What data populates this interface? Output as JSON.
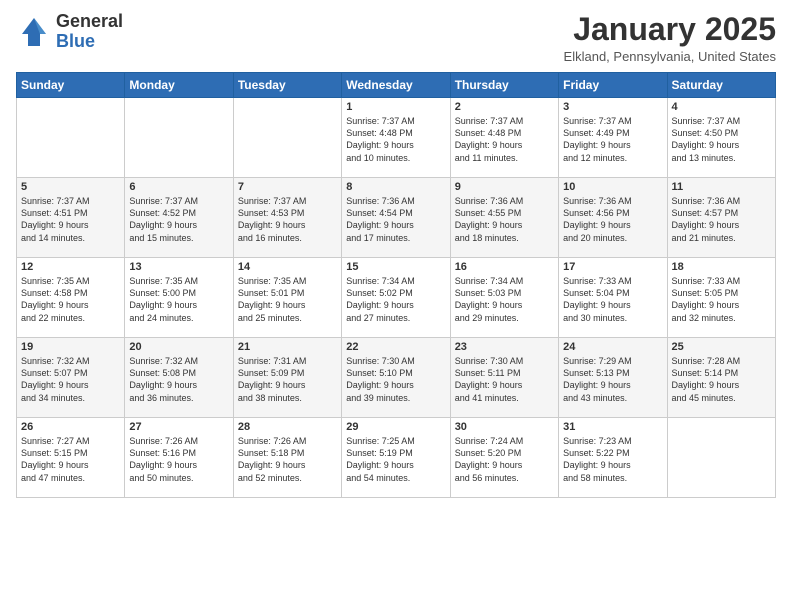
{
  "header": {
    "logo_general": "General",
    "logo_blue": "Blue",
    "month_title": "January 2025",
    "location": "Elkland, Pennsylvania, United States"
  },
  "weekdays": [
    "Sunday",
    "Monday",
    "Tuesday",
    "Wednesday",
    "Thursday",
    "Friday",
    "Saturday"
  ],
  "weeks": [
    [
      {
        "day": "",
        "info": ""
      },
      {
        "day": "",
        "info": ""
      },
      {
        "day": "",
        "info": ""
      },
      {
        "day": "1",
        "info": "Sunrise: 7:37 AM\nSunset: 4:48 PM\nDaylight: 9 hours\nand 10 minutes."
      },
      {
        "day": "2",
        "info": "Sunrise: 7:37 AM\nSunset: 4:48 PM\nDaylight: 9 hours\nand 11 minutes."
      },
      {
        "day": "3",
        "info": "Sunrise: 7:37 AM\nSunset: 4:49 PM\nDaylight: 9 hours\nand 12 minutes."
      },
      {
        "day": "4",
        "info": "Sunrise: 7:37 AM\nSunset: 4:50 PM\nDaylight: 9 hours\nand 13 minutes."
      }
    ],
    [
      {
        "day": "5",
        "info": "Sunrise: 7:37 AM\nSunset: 4:51 PM\nDaylight: 9 hours\nand 14 minutes."
      },
      {
        "day": "6",
        "info": "Sunrise: 7:37 AM\nSunset: 4:52 PM\nDaylight: 9 hours\nand 15 minutes."
      },
      {
        "day": "7",
        "info": "Sunrise: 7:37 AM\nSunset: 4:53 PM\nDaylight: 9 hours\nand 16 minutes."
      },
      {
        "day": "8",
        "info": "Sunrise: 7:36 AM\nSunset: 4:54 PM\nDaylight: 9 hours\nand 17 minutes."
      },
      {
        "day": "9",
        "info": "Sunrise: 7:36 AM\nSunset: 4:55 PM\nDaylight: 9 hours\nand 18 minutes."
      },
      {
        "day": "10",
        "info": "Sunrise: 7:36 AM\nSunset: 4:56 PM\nDaylight: 9 hours\nand 20 minutes."
      },
      {
        "day": "11",
        "info": "Sunrise: 7:36 AM\nSunset: 4:57 PM\nDaylight: 9 hours\nand 21 minutes."
      }
    ],
    [
      {
        "day": "12",
        "info": "Sunrise: 7:35 AM\nSunset: 4:58 PM\nDaylight: 9 hours\nand 22 minutes."
      },
      {
        "day": "13",
        "info": "Sunrise: 7:35 AM\nSunset: 5:00 PM\nDaylight: 9 hours\nand 24 minutes."
      },
      {
        "day": "14",
        "info": "Sunrise: 7:35 AM\nSunset: 5:01 PM\nDaylight: 9 hours\nand 25 minutes."
      },
      {
        "day": "15",
        "info": "Sunrise: 7:34 AM\nSunset: 5:02 PM\nDaylight: 9 hours\nand 27 minutes."
      },
      {
        "day": "16",
        "info": "Sunrise: 7:34 AM\nSunset: 5:03 PM\nDaylight: 9 hours\nand 29 minutes."
      },
      {
        "day": "17",
        "info": "Sunrise: 7:33 AM\nSunset: 5:04 PM\nDaylight: 9 hours\nand 30 minutes."
      },
      {
        "day": "18",
        "info": "Sunrise: 7:33 AM\nSunset: 5:05 PM\nDaylight: 9 hours\nand 32 minutes."
      }
    ],
    [
      {
        "day": "19",
        "info": "Sunrise: 7:32 AM\nSunset: 5:07 PM\nDaylight: 9 hours\nand 34 minutes."
      },
      {
        "day": "20",
        "info": "Sunrise: 7:32 AM\nSunset: 5:08 PM\nDaylight: 9 hours\nand 36 minutes."
      },
      {
        "day": "21",
        "info": "Sunrise: 7:31 AM\nSunset: 5:09 PM\nDaylight: 9 hours\nand 38 minutes."
      },
      {
        "day": "22",
        "info": "Sunrise: 7:30 AM\nSunset: 5:10 PM\nDaylight: 9 hours\nand 39 minutes."
      },
      {
        "day": "23",
        "info": "Sunrise: 7:30 AM\nSunset: 5:11 PM\nDaylight: 9 hours\nand 41 minutes."
      },
      {
        "day": "24",
        "info": "Sunrise: 7:29 AM\nSunset: 5:13 PM\nDaylight: 9 hours\nand 43 minutes."
      },
      {
        "day": "25",
        "info": "Sunrise: 7:28 AM\nSunset: 5:14 PM\nDaylight: 9 hours\nand 45 minutes."
      }
    ],
    [
      {
        "day": "26",
        "info": "Sunrise: 7:27 AM\nSunset: 5:15 PM\nDaylight: 9 hours\nand 47 minutes."
      },
      {
        "day": "27",
        "info": "Sunrise: 7:26 AM\nSunset: 5:16 PM\nDaylight: 9 hours\nand 50 minutes."
      },
      {
        "day": "28",
        "info": "Sunrise: 7:26 AM\nSunset: 5:18 PM\nDaylight: 9 hours\nand 52 minutes."
      },
      {
        "day": "29",
        "info": "Sunrise: 7:25 AM\nSunset: 5:19 PM\nDaylight: 9 hours\nand 54 minutes."
      },
      {
        "day": "30",
        "info": "Sunrise: 7:24 AM\nSunset: 5:20 PM\nDaylight: 9 hours\nand 56 minutes."
      },
      {
        "day": "31",
        "info": "Sunrise: 7:23 AM\nSunset: 5:22 PM\nDaylight: 9 hours\nand 58 minutes."
      },
      {
        "day": "",
        "info": ""
      }
    ]
  ]
}
